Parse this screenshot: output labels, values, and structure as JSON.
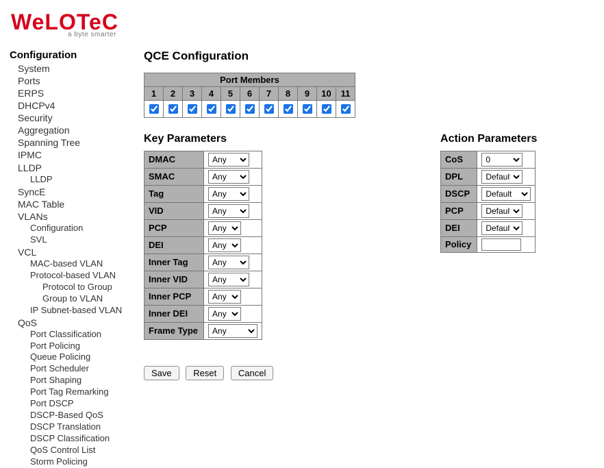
{
  "brand": {
    "name": "WeLOTeC",
    "tagline": "a byte smarter"
  },
  "sidebar": {
    "title": "Configuration",
    "items": [
      {
        "label": "System"
      },
      {
        "label": "Ports"
      },
      {
        "label": "ERPS"
      },
      {
        "label": "DHCPv4"
      },
      {
        "label": "Security"
      },
      {
        "label": "Aggregation"
      },
      {
        "label": "Spanning Tree"
      },
      {
        "label": "IPMC"
      },
      {
        "label": "LLDP",
        "children": [
          {
            "label": "LLDP"
          }
        ]
      },
      {
        "label": "SyncE"
      },
      {
        "label": "MAC Table"
      },
      {
        "label": "VLANs",
        "children": [
          {
            "label": "Configuration"
          },
          {
            "label": "SVL"
          }
        ]
      },
      {
        "label": "VCL",
        "children": [
          {
            "label": "MAC-based VLAN"
          },
          {
            "label": "Protocol-based VLAN",
            "children": [
              {
                "label": "Protocol to Group"
              },
              {
                "label": "Group to VLAN"
              }
            ]
          },
          {
            "label": "IP Subnet-based VLAN"
          }
        ]
      },
      {
        "label": "QoS",
        "children": [
          {
            "label": "Port Classification"
          },
          {
            "label": "Port Policing"
          },
          {
            "label": "Queue Policing"
          },
          {
            "label": "Port Scheduler"
          },
          {
            "label": "Port Shaping"
          },
          {
            "label": "Port Tag Remarking"
          },
          {
            "label": "Port DSCP"
          },
          {
            "label": "DSCP-Based QoS"
          },
          {
            "label": "DSCP Translation"
          },
          {
            "label": "DSCP Classification"
          },
          {
            "label": "QoS Control List"
          },
          {
            "label": "Storm Policing"
          }
        ]
      }
    ]
  },
  "main": {
    "title": "QCE Configuration",
    "port_members": {
      "header": "Port Members",
      "ports": [
        {
          "num": "1",
          "checked": true
        },
        {
          "num": "2",
          "checked": true
        },
        {
          "num": "3",
          "checked": true
        },
        {
          "num": "4",
          "checked": true
        },
        {
          "num": "5",
          "checked": true
        },
        {
          "num": "6",
          "checked": true
        },
        {
          "num": "7",
          "checked": true
        },
        {
          "num": "8",
          "checked": true
        },
        {
          "num": "9",
          "checked": true
        },
        {
          "num": "10",
          "checked": true
        },
        {
          "num": "11",
          "checked": true
        }
      ]
    },
    "key_params": {
      "heading": "Key Parameters",
      "rows": [
        {
          "label": "DMAC",
          "value": "Any",
          "w": "w60"
        },
        {
          "label": "SMAC",
          "value": "Any",
          "w": "w60"
        },
        {
          "label": "Tag",
          "value": "Any",
          "w": "w60"
        },
        {
          "label": "VID",
          "value": "Any",
          "w": "w60"
        },
        {
          "label": "PCP",
          "value": "Any",
          "w": "w48"
        },
        {
          "label": "DEI",
          "value": "Any",
          "w": "w48"
        },
        {
          "label": "Inner Tag",
          "value": "Any",
          "w": "w60"
        },
        {
          "label": "Inner VID",
          "value": "Any",
          "w": "w60"
        },
        {
          "label": "Inner PCP",
          "value": "Any",
          "w": "w48"
        },
        {
          "label": "Inner DEI",
          "value": "Any",
          "w": "w48"
        },
        {
          "label": "Frame Type",
          "value": "Any",
          "w": "w72"
        }
      ]
    },
    "action_params": {
      "heading": "Action Parameters",
      "rows": [
        {
          "label": "CoS",
          "value": "0",
          "type": "select",
          "w": "w60"
        },
        {
          "label": "DPL",
          "value": "Default",
          "type": "select",
          "w": "w60"
        },
        {
          "label": "DSCP",
          "value": "Default",
          "type": "select",
          "w": "w72"
        },
        {
          "label": "PCP",
          "value": "Default",
          "type": "select",
          "w": "w60"
        },
        {
          "label": "DEI",
          "value": "Default",
          "type": "select",
          "w": "w60"
        },
        {
          "label": "Policy",
          "value": "",
          "type": "text"
        }
      ]
    },
    "buttons": {
      "save": "Save",
      "reset": "Reset",
      "cancel": "Cancel"
    }
  }
}
